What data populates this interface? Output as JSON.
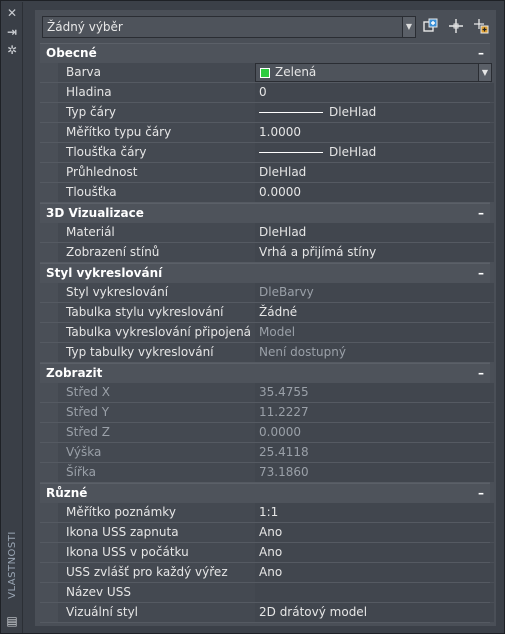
{
  "window": {
    "side_title": "VLASTNOSTI",
    "close_glyph": "✕",
    "pin_glyph": "⇥",
    "settings_glyph": "✲",
    "bottom_glyph": "▤"
  },
  "toolbar": {
    "selection_value": "Žádný výběr",
    "arrow": "▼",
    "quick_select_icon": "quick-select-icon",
    "pickadd_icon": "pick-point-icon",
    "select_objects_icon": "select-objects-icon"
  },
  "sections": {
    "general": {
      "title": "Obecné",
      "collapse": "–",
      "rows": [
        {
          "name": "Barva",
          "value": "Zelená"
        },
        {
          "name": "Hladina",
          "value": "0"
        },
        {
          "name": "Typ čáry",
          "value": "DleHlad"
        },
        {
          "name": "Měřítko typu čáry",
          "value": "1.0000"
        },
        {
          "name": "Tloušťka čáry",
          "value": "DleHlad"
        },
        {
          "name": "Průhlednost",
          "value": "DleHlad"
        },
        {
          "name": "Tloušťka",
          "value": "0.0000"
        }
      ]
    },
    "viz3d": {
      "title": "3D Vizualizace",
      "collapse": "–",
      "rows": [
        {
          "name": "Materiál",
          "value": "DleHlad"
        },
        {
          "name": "Zobrazení stínů",
          "value": "Vrhá a přijímá stíny"
        }
      ]
    },
    "plotstyle": {
      "title": "Styl vykreslování",
      "collapse": "–",
      "rows": [
        {
          "name": "Styl vykreslování",
          "value": "DleBarvy"
        },
        {
          "name": "Tabulka stylu vykreslování",
          "value": "Žádné"
        },
        {
          "name": "Tabulka vykreslování připojená k",
          "value": "Model"
        },
        {
          "name": "Typ tabulky vykreslování",
          "value": "Není dostupný"
        }
      ]
    },
    "view": {
      "title": "Zobrazit",
      "collapse": "–",
      "rows": [
        {
          "name": "Střed X",
          "value": "35.4755"
        },
        {
          "name": "Střed Y",
          "value": "11.2227"
        },
        {
          "name": "Střed Z",
          "value": "0.0000"
        },
        {
          "name": "Výška",
          "value": "25.4118"
        },
        {
          "name": "Šířka",
          "value": "73.1860"
        }
      ]
    },
    "misc": {
      "title": "Různé",
      "collapse": "–",
      "rows": [
        {
          "name": "Měřítko poznámky",
          "value": "1:1"
        },
        {
          "name": "Ikona USS zapnuta",
          "value": "Ano"
        },
        {
          "name": "Ikona USS v počátku",
          "value": "Ano"
        },
        {
          "name": "USS zvlášť pro každý výřez",
          "value": "Ano"
        },
        {
          "name": "Název USS",
          "value": ""
        },
        {
          "name": "Vizuální styl",
          "value": "2D drátový model"
        }
      ]
    }
  },
  "colors": {
    "color_swatch": "#2ecc40"
  }
}
